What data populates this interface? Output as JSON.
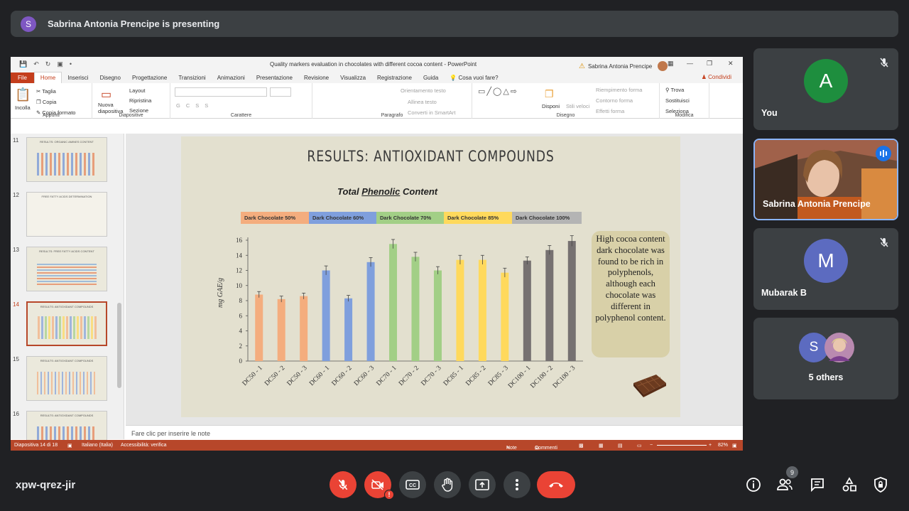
{
  "meet": {
    "presenting_text": "Sabrina Antonia Prencipe is presenting",
    "presenter_initial": "S",
    "meeting_code": "xpw-qrez-jir",
    "participants_count": "9",
    "tiles": [
      {
        "initial": "A",
        "name": "You",
        "color": "#1e8e3e",
        "muted": true
      },
      {
        "initial": "",
        "name": "Sabrina Antonia Prencipe",
        "speaking": true
      },
      {
        "initial": "M",
        "name": "Mubarak B",
        "color": "#5c6bc0",
        "muted": true
      },
      {
        "initial": "S",
        "name": "5 others",
        "color": "#5c6bc0"
      }
    ],
    "accent_red": "#ea4335"
  },
  "powerpoint": {
    "window_title": "Quality markers evaluation in chocolates with different cocoa content  -  PowerPoint",
    "user_name": "Sabrina Antonia Prencipe",
    "tabs": [
      "File",
      "Home",
      "Inserisci",
      "Disegno",
      "Progettazione",
      "Transizioni",
      "Animazioni",
      "Presentazione",
      "Revisione",
      "Visualizza",
      "Registrazione",
      "Guida"
    ],
    "tell_me": "Cosa vuoi fare?",
    "share": "Condividi",
    "ribbon": {
      "paste": "Incolla",
      "cut": "Taglia",
      "copy": "Copia",
      "format_painter": "Copia formato",
      "new_slide": "Nuova diapositiva",
      "layout": "Layout",
      "reset": "Ripristina",
      "section": "Sezione",
      "text_direction": "Orientamento testo",
      "align_text": "Allinea testo",
      "smartart": "Converti in SmartArt",
      "arrange": "Disponi",
      "quick_styles": "Stili veloci",
      "shape_fill": "Riempimento forma",
      "shape_outline": "Contorno forma",
      "shape_effects": "Effetti forma",
      "find": "Trova",
      "replace": "Sostituisci",
      "select": "Seleziona",
      "groups": [
        "Appunti",
        "Diapositive",
        "Carattere",
        "Paragrafo",
        "Disegno",
        "Modifica"
      ]
    },
    "thumbnails": [
      {
        "num": "11",
        "title": "RESULTS: ORGANIC AMINES CONTENT"
      },
      {
        "num": "12",
        "title": "FREE FATTY ACIDS DETERMINATION"
      },
      {
        "num": "13",
        "title": "RESULTS: FREE FATTY ACIDS CONTENT"
      },
      {
        "num": "14",
        "title": "RESULTS: ANTIOXIDANT COMPOUNDS"
      },
      {
        "num": "15",
        "title": "RESULTS: ANTIOXIDANT COMPOUNDS"
      },
      {
        "num": "16",
        "title": "RESULTS: ANTIOXIDANT COMPOUNDS"
      }
    ],
    "notes_placeholder": "Fare clic per inserire le note",
    "status": {
      "slide_of": "Diapositiva 14 di 18",
      "language": "Italiano (Italia)",
      "accessibility": "Accessibilità: verifica",
      "notes": "Note",
      "comments": "Commenti",
      "zoom": "82%"
    }
  },
  "slide": {
    "title": "RESULTS: ANTIOXIDANT COMPOUNDS",
    "chart_title_prefix": "Total ",
    "chart_title_underlined": "Phenolic",
    "chart_title_suffix": " Content",
    "callout": "High cocoa content dark chocolate was found to be rich in polyphenols, although each chocolate was different in polyphenol content."
  },
  "chart_data": {
    "type": "bar",
    "ylabel": "mg GAE/g",
    "ylim": [
      0,
      16
    ],
    "yticks": [
      0,
      2,
      4,
      6,
      8,
      10,
      12,
      14,
      16
    ],
    "categories": [
      "DC50 - 1",
      "DC50 - 2",
      "DC50 - 3",
      "DC60 - 1",
      "DC60 - 2",
      "DC60 - 3",
      "DC70 - 1",
      "DC70 - 2",
      "DC70 - 3",
      "DC85 - 1",
      "DC85 - 2",
      "DC85 - 3",
      "DC100 - 1",
      "DC100 - 2",
      "DC100 - 3"
    ],
    "values": [
      8.8,
      8.2,
      8.6,
      12.0,
      8.3,
      13.1,
      15.5,
      13.8,
      12.0,
      13.4,
      13.4,
      11.7,
      13.3,
      14.7,
      15.9
    ],
    "errors": [
      0.4,
      0.4,
      0.4,
      0.6,
      0.4,
      0.6,
      0.6,
      0.6,
      0.5,
      0.6,
      0.6,
      0.6,
      0.5,
      0.6,
      0.7
    ],
    "groups": [
      {
        "name": "Dark Chocolate 50%",
        "color": "#f4ad7e"
      },
      {
        "name": "Dark Chocolate 60%",
        "color": "#7f9fdd"
      },
      {
        "name": "Dark Chocolate 70%",
        "color": "#a2cf86"
      },
      {
        "name": "Dark Chocolate 85%",
        "color": "#ffd95c"
      },
      {
        "name": "Dark Chocolate 100%",
        "color": "#767171"
      }
    ]
  }
}
